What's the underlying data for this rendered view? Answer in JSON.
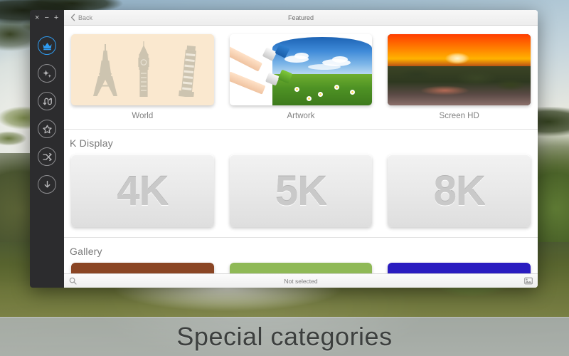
{
  "desktop": {
    "caption": "Special categories"
  },
  "window": {
    "titlebar": {
      "back_label": "Back",
      "back_icon": "chevron-left-icon",
      "title": "Featured"
    },
    "sidebar": {
      "window_controls": [
        {
          "name": "close",
          "glyph": "×"
        },
        {
          "name": "minimize",
          "glyph": "−"
        },
        {
          "name": "zoom",
          "glyph": "+"
        }
      ],
      "items": [
        {
          "name": "featured",
          "icon": "crown-icon",
          "active": true
        },
        {
          "name": "new",
          "icon": "sparkle-icon",
          "active": false
        },
        {
          "name": "shuffle-loop",
          "icon": "loop-arrow-icon",
          "active": false
        },
        {
          "name": "favorites",
          "icon": "star-outline-icon",
          "active": false
        },
        {
          "name": "random",
          "icon": "shuffle-icon",
          "active": false
        },
        {
          "name": "downloads",
          "icon": "download-arrow-icon",
          "active": false
        }
      ],
      "accent_color": "#2f9bf0",
      "background_color": "#2c2c2e"
    },
    "sections": [
      {
        "heading": null,
        "cards": [
          {
            "label": "World",
            "thumb": "landmarks-illustration"
          },
          {
            "label": "Artwork",
            "thumb": "paintbrush-landscape-photo"
          },
          {
            "label": "Screen HD",
            "thumb": "sunset-rocky-coast-photo"
          }
        ]
      },
      {
        "heading": "K Display",
        "cards": [
          {
            "label": "4K"
          },
          {
            "label": "5K"
          },
          {
            "label": "8K"
          }
        ]
      },
      {
        "heading": "Gallery",
        "cards": [
          {
            "color": "#8a4524"
          },
          {
            "color": "#8fb956"
          },
          {
            "color": "#2a1cc0"
          }
        ]
      }
    ],
    "statusbar": {
      "search_icon": "magnifier-icon",
      "status_text": "Not selected",
      "preview_icon": "picture-icon"
    }
  }
}
